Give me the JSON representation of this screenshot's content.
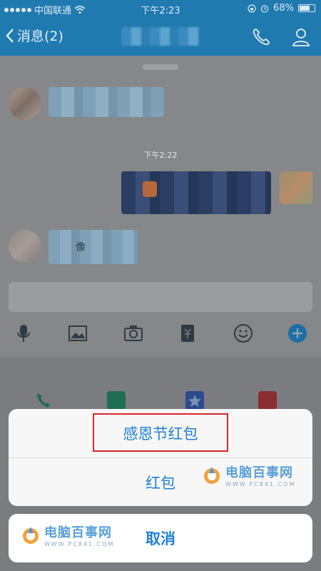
{
  "status_bar": {
    "carrier": "中国联通",
    "time": "下午2:23",
    "battery": "68%"
  },
  "nav": {
    "back_label": "消息(2)"
  },
  "chat": {
    "timestamp": "下午2:22",
    "partial_char": "像"
  },
  "action_sheet": {
    "options": [
      {
        "label": "感恩节红包"
      },
      {
        "label": "红包"
      }
    ],
    "cancel_label": "取消"
  },
  "watermark": {
    "text": "电脑百事网",
    "sub": "WWW.PC841.COM"
  },
  "colors": {
    "nav_bar": "#1f7ab0",
    "sheet_text": "#1e7fd6",
    "highlight_border": "#d9262c"
  }
}
